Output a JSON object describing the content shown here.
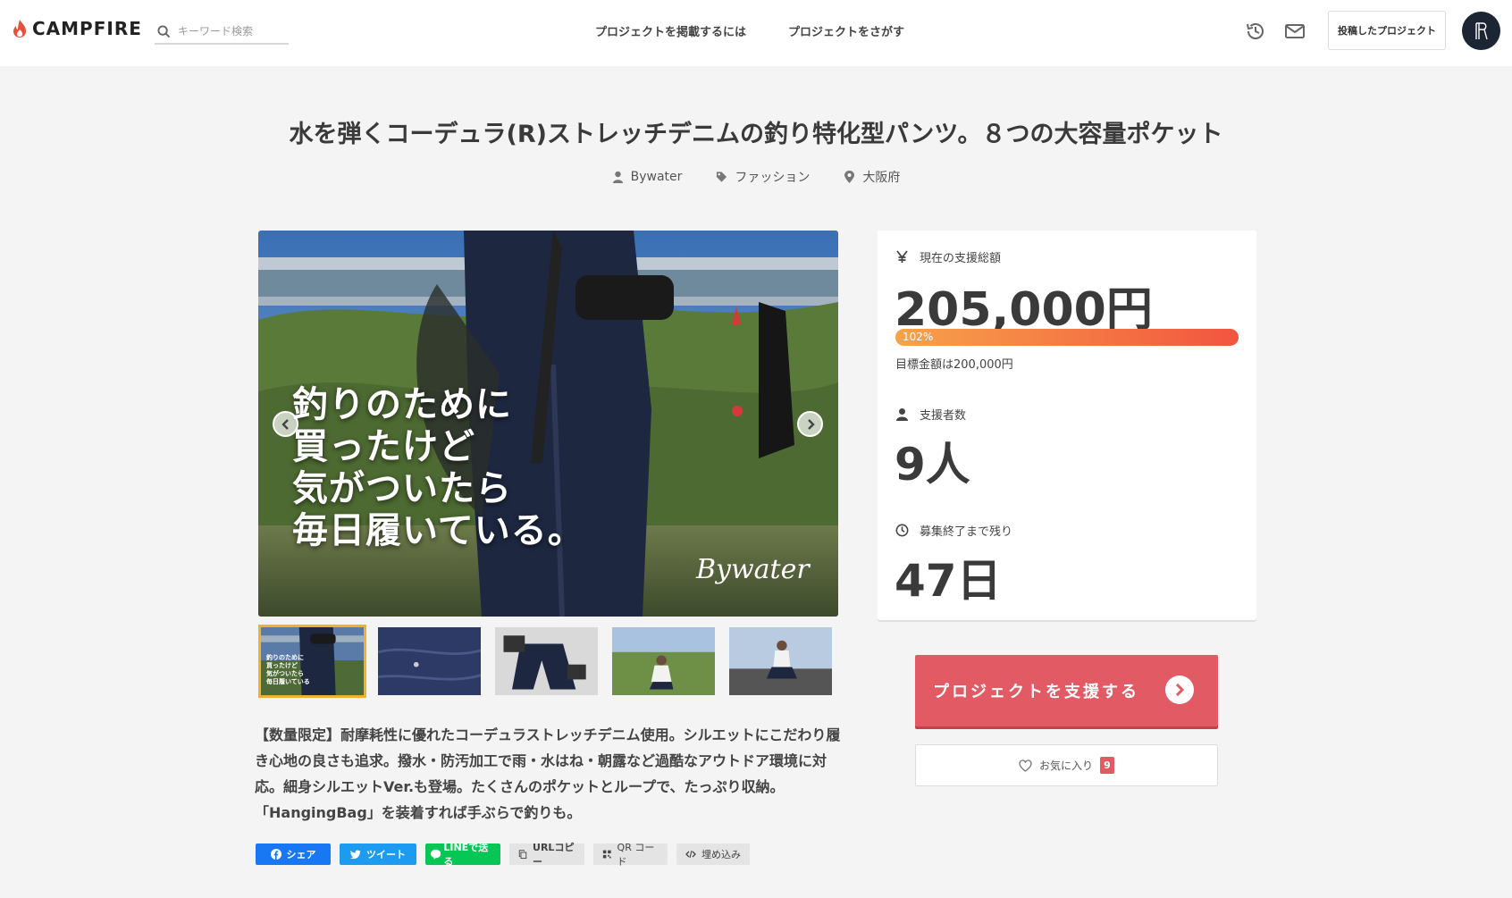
{
  "header": {
    "logo_text": "CAMPFIRE",
    "search_placeholder": "キーワード検索",
    "nav": [
      "プロジェクトを掲載するには",
      "プロジェクトをさがす"
    ],
    "posted_button": "投稿したプロジェクト",
    "icons": [
      "history-icon",
      "mail-icon",
      "avatar"
    ]
  },
  "project": {
    "title": "水を弾くコーデュラ(R)ストレッチデニムの釣り特化型パンツ。８つの大容量ポケット",
    "owner": "Bywater",
    "category": "ファッション",
    "location": "大阪府"
  },
  "gallery": {
    "hero_text": "釣りのために\n買ったけど\n気がついたら\n毎日履いている。",
    "hero_brand": "Bywater",
    "thumb_label": "釣りのために\n買ったけど\n気がついたら\n毎日履いている",
    "thumb_count": 5
  },
  "description": "【数量限定】耐摩耗性に優れたコーデュラストレッチデニム使用。シルエットにこだわり履き心地の良さも追求。撥水・防汚加工で雨・水はね・朝露など過酷なアウトドア環境に対応。細身シルエットVer.も登場。たくさんのポケットとループで、たっぷり収納。「HangingBag」を装着すれば手ぶらで釣りも。",
  "share": {
    "facebook": "シェア",
    "twitter": "ツイート",
    "line": "LINEで送る",
    "url_copy": "URLコピー",
    "qr": "QR コード",
    "embed": "埋め込み"
  },
  "stats": {
    "total_label": "現在の支援総額",
    "total_value": "205,000円",
    "progress_text": "102%",
    "progress_percent": 102,
    "goal_text": "目標金額は200,000円",
    "backers_label": "支援者数",
    "backers_value": "9人",
    "remaining_label": "募集終了まで残り",
    "remaining_value": "47日"
  },
  "actions": {
    "support_label": "プロジェクトを支援する",
    "favorite_label": "お気に入り",
    "favorite_count": "9"
  },
  "colors": {
    "accent": "#e15a64",
    "progress_start": "#f7a24a",
    "progress_end": "#f2553f",
    "facebook": "#1877f2",
    "twitter": "#1d9bf0",
    "line": "#06c755"
  }
}
